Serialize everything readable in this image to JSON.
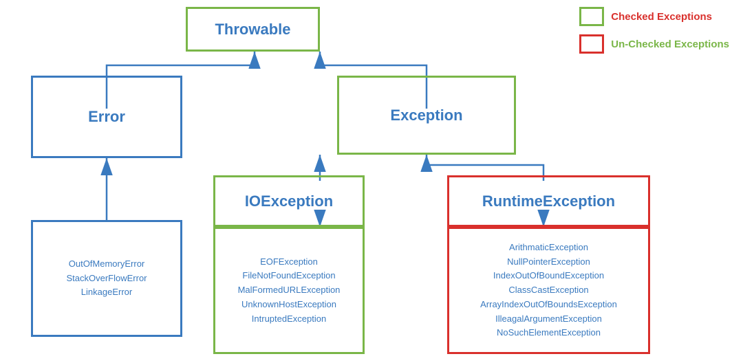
{
  "legend": {
    "checked_label": "Checked Exceptions",
    "unchecked_label": "Un-Checked Exceptions"
  },
  "boxes": {
    "throwable": {
      "label": "Throwable"
    },
    "error": {
      "label": "Error"
    },
    "exception": {
      "label": "Exception"
    },
    "ioexception": {
      "label": "IOException"
    },
    "runtime_exception": {
      "label": "RuntimeException"
    },
    "error_children": {
      "items": [
        "OutOfMemoryError",
        "StackOverFlowError",
        "LinkageError"
      ]
    },
    "ioexception_children": {
      "items": [
        "EOFException",
        "FileNotFoundException",
        "MalFormedURLException",
        "UnknownHostException",
        "IntruptedException"
      ]
    },
    "runtime_children": {
      "items": [
        "ArithmaticException",
        "NullPointerException",
        "IndexOutOfBoundException",
        "ClassCastException",
        "ArrayIndexOutOfBoundsException",
        "IlleagalArgumentException",
        "NoSuchElementException"
      ]
    }
  }
}
